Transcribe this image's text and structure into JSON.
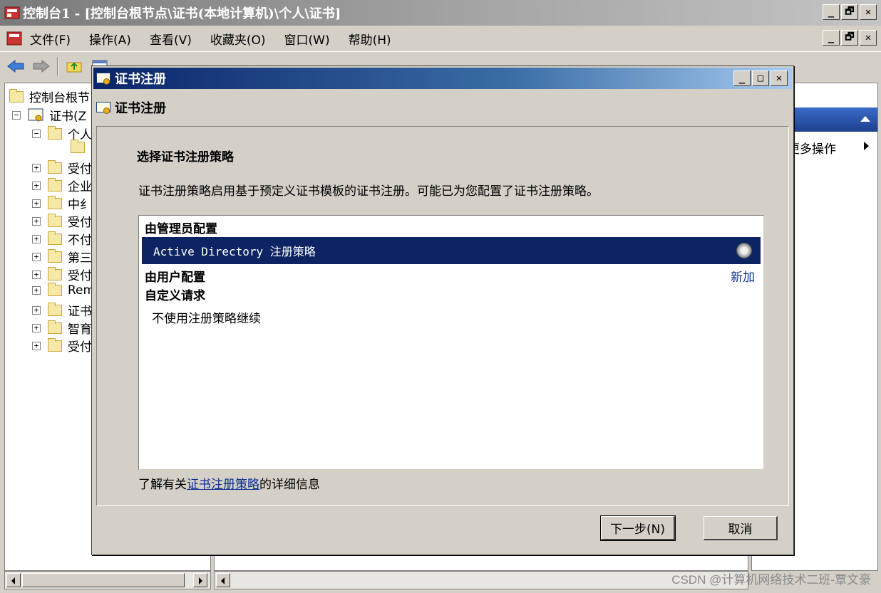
{
  "main_window": {
    "title": "控制台1 - [控制台根节点\\证书(本地计算机)\\个人\\证书]",
    "menu": [
      "文件(F)",
      "操作(A)",
      "查看(V)",
      "收藏夹(O)",
      "窗口(W)",
      "帮助(H)"
    ],
    "window_buttons": [
      "_",
      "🗗",
      "✕"
    ]
  },
  "tree": {
    "root": "控制台根节",
    "cert_node": "证书(Z",
    "personal": "个人",
    "children": [
      "受付",
      "企业",
      "中纟",
      "受付",
      "不付",
      "第三",
      "受付",
      "Rem",
      "证书",
      "智育",
      "受付"
    ]
  },
  "actions": {
    "more": "更多操作"
  },
  "dialog": {
    "title": "证书注册",
    "header": "证书注册",
    "section_title": "选择证书注册策略",
    "description": "证书注册策略启用基于预定义证书模板的证书注册。可能已为您配置了证书注册策略。",
    "admin_group": "由管理员配置",
    "admin_policy": "Active Directory 注册策略",
    "user_group": "由用户配置",
    "add_link": "新加",
    "custom_group": "自定义请求",
    "no_policy": "不使用注册策略继续",
    "learn_prefix": "了解有关",
    "learn_link": "证书注册策略",
    "learn_suffix": "的详细信息",
    "next_button": "下一步(N)",
    "cancel_button": "取消"
  },
  "watermark": "CSDN @计算机网络技术二班-覃文豪",
  "colors": {
    "selection": "#0c2463",
    "link": "#0a2d8f",
    "dialog_bg": "#d4d0c8"
  }
}
